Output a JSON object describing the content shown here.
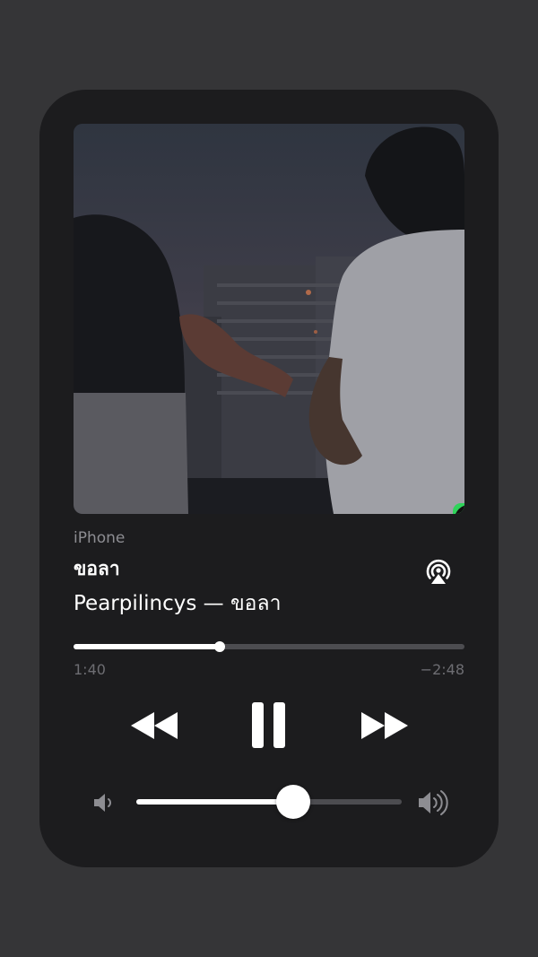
{
  "now_playing": {
    "device_label": "iPhone",
    "title": "ขอลา",
    "subtitle": "Pearpilincys — ขอลา",
    "elapsed": "1:40",
    "remaining": "−2:48",
    "progress_fraction": 0.373,
    "volume_fraction": 0.59
  },
  "icons": {
    "app_badge": "music-app-icon",
    "airplay": "airplay-audio-icon",
    "rewind": "rewind-icon",
    "pause": "pause-icon",
    "forward": "fast-forward-icon",
    "volume_low": "speaker-low-icon",
    "volume_high": "speaker-high-icon"
  },
  "colors": {
    "page_background": "#353537",
    "card_background": "#1c1c1e",
    "app_badge": "#2fd35a",
    "track_inactive": "#4c4c50",
    "primary_text": "#ffffff",
    "secondary_text": "#8d8d92"
  }
}
